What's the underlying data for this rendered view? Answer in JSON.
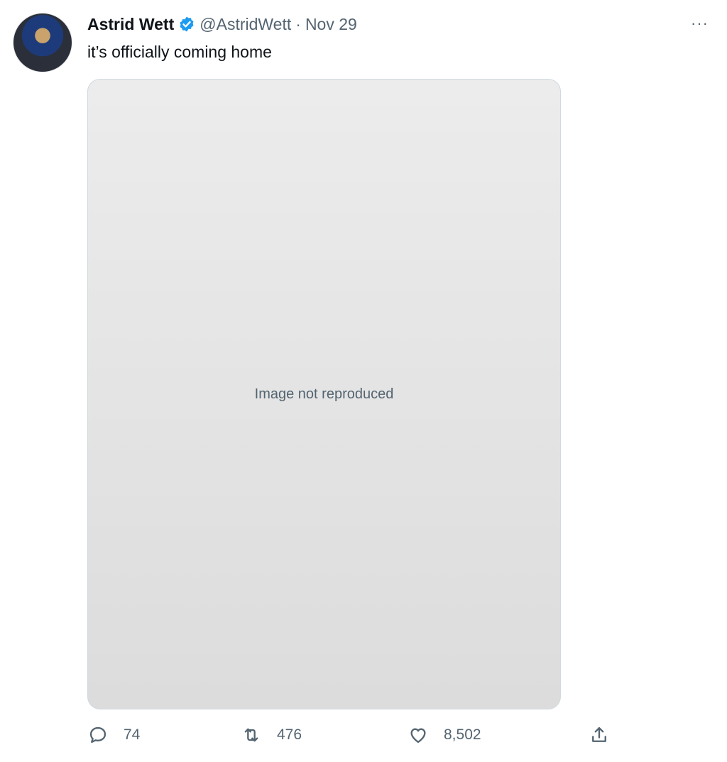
{
  "tweet": {
    "author_name": "Astrid Wett",
    "handle": "@AstridWett",
    "separator": "·",
    "date": "Nov 29",
    "text": "it’s officially coming home",
    "more_label": "···"
  },
  "media": {
    "note": "Image not reproduced"
  },
  "actions": {
    "replies": "74",
    "retweets": "476",
    "likes": "8,502"
  },
  "colors": {
    "verified": "#1d9bf0",
    "secondary_text": "#536471",
    "primary_text": "#0f1419"
  }
}
